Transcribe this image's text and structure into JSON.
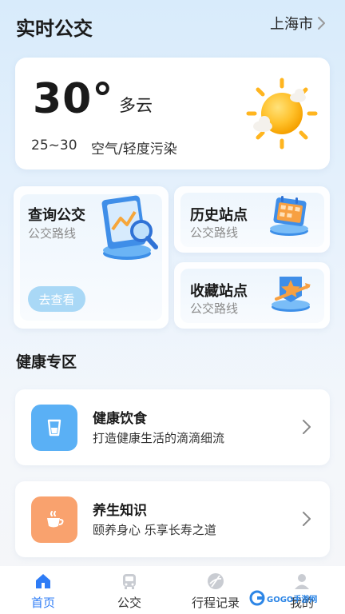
{
  "header": {
    "title": "实时公交",
    "city": "上海市"
  },
  "weather": {
    "temperature": "30°",
    "condition": "多云",
    "range": "25~30",
    "air_quality": "空气/轻度污染"
  },
  "cards": {
    "query": {
      "title": "查询公交",
      "subtitle": "公交路线",
      "button": "去查看"
    },
    "history": {
      "title": "历史站点",
      "subtitle": "公交路线"
    },
    "favorites": {
      "title": "收藏站点",
      "subtitle": "公交路线"
    }
  },
  "health": {
    "section_title": "健康专区",
    "items": [
      {
        "title": "健康饮食",
        "subtitle": "打造健康生活的滴滴细流",
        "icon": "cup-icon",
        "color": "#5ab0f5"
      },
      {
        "title": "养生知识",
        "subtitle": "颐养身心 乐享长寿之道",
        "icon": "tea-icon",
        "color": "#f9a26e"
      }
    ]
  },
  "tabbar": {
    "tabs": [
      {
        "label": "首页",
        "icon": "home-icon",
        "active": true
      },
      {
        "label": "公交",
        "icon": "bus-icon",
        "active": false
      },
      {
        "label": "行程记录",
        "icon": "record-icon",
        "active": false
      },
      {
        "label": "我的",
        "icon": "profile-icon",
        "active": false
      }
    ],
    "accent": "#2e7cf6"
  },
  "watermark": {
    "text": "GOGO手游网"
  }
}
